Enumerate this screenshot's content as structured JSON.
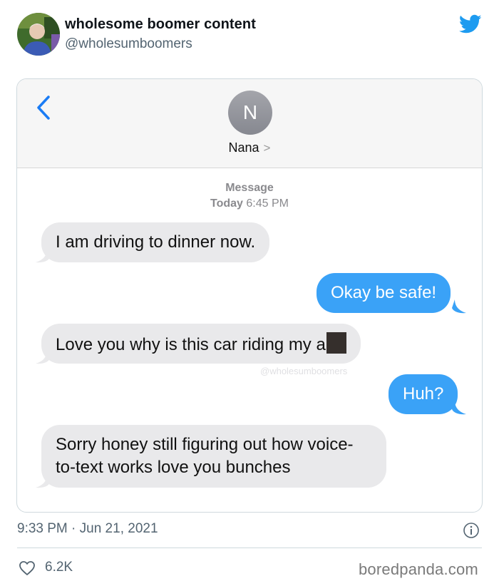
{
  "tweet": {
    "display_name": "wholesome boomer content",
    "handle": "@wholesumboomers",
    "timestamp": "9:33 PM · Jun 21, 2021",
    "likes": "6.2K",
    "icons": [
      "twitter-bird-icon",
      "info-icon",
      "heart-icon"
    ],
    "brand_color": "#1d9bf0"
  },
  "imessage": {
    "contact_initial": "N",
    "contact_name": "Nana",
    "contact_chevron": ">",
    "meta_line1": "Message",
    "meta_today": "Today",
    "meta_time": "6:45 PM",
    "watermark": "@wholesumboomers",
    "messages": [
      {
        "side": "received",
        "text": "I am driving to dinner now."
      },
      {
        "side": "sent",
        "text": "Okay be safe!"
      },
      {
        "side": "received",
        "text": "Love you why is this car riding my a"
      },
      {
        "side": "sent",
        "text": "Huh?"
      },
      {
        "side": "received",
        "text": "Sorry honey still figuring out how voice-to-text works love you bunches"
      }
    ],
    "colors": {
      "sent": "#3aa2f7",
      "received": "#e9e9eb",
      "back_chevron": "#1a7cf5"
    }
  },
  "source": "boredpanda.com"
}
